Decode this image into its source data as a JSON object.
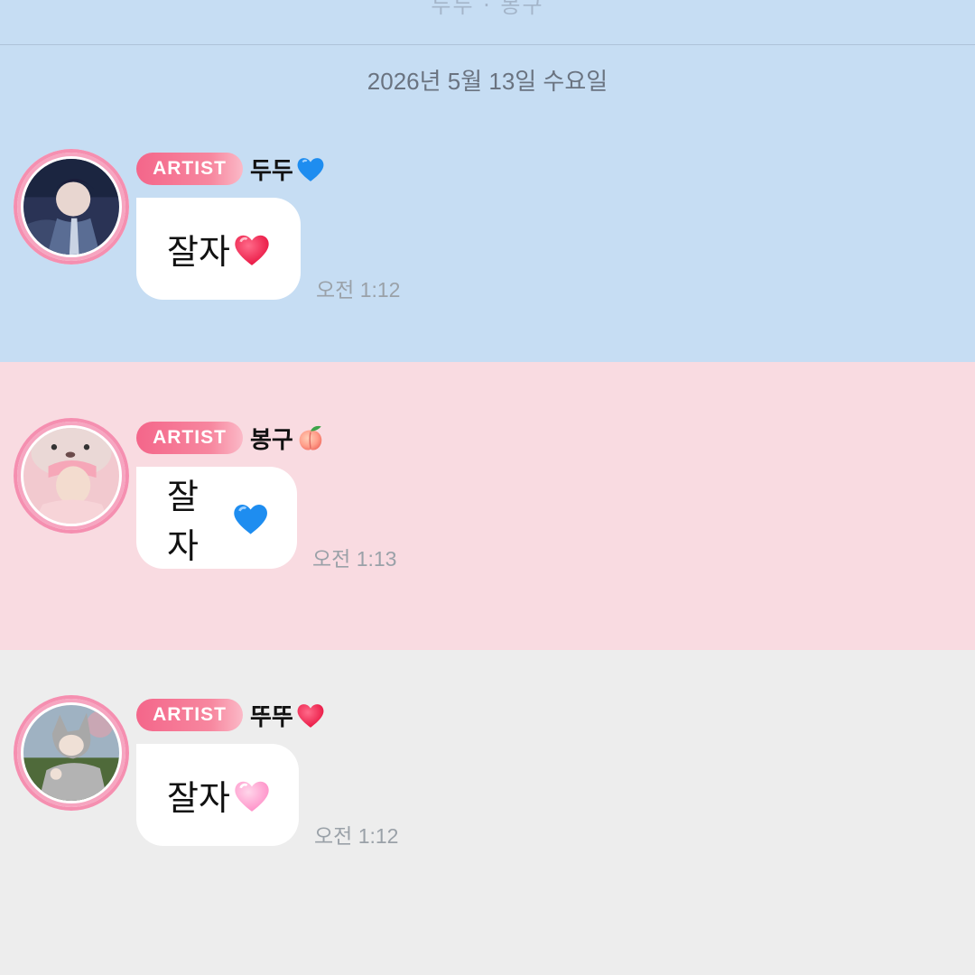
{
  "header": {
    "cutoff_text": "두두 · 봉구",
    "date_separator": "2026년 5월 13일 수요일"
  },
  "messages": [
    {
      "badge": "ARTIST",
      "name": "두두",
      "name_emoji": "blue-heart-icon",
      "text": "잘자",
      "text_emoji": "red-heart-icon",
      "time": "오전 1:12"
    },
    {
      "badge": "ARTIST",
      "name": "봉구",
      "name_emoji": "peach-icon",
      "text": "잘자",
      "text_emoji": "blue-heart-icon",
      "time": "오전 1:13"
    },
    {
      "badge": "ARTIST",
      "name": "뚜뚜",
      "name_emoji": "red-heart-icon",
      "text": "잘자",
      "text_emoji": "pink-heart-icon",
      "time": "오전 1:12"
    }
  ],
  "colors": {
    "panel_blue": "#c6ddf3",
    "panel_pink": "#f9dbe1",
    "panel_gray": "#ededed",
    "badge_gradient_start": "#f4668a",
    "badge_gradient_end": "#fbb9c7",
    "avatar_ring": "#f58fb0",
    "timestamp": "#9aa1a8"
  }
}
